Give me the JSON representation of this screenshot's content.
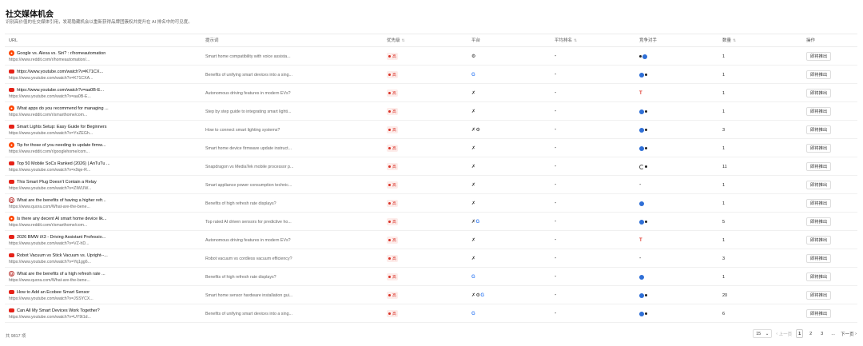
{
  "header": {
    "title": "社交媒体机会",
    "subtitle": "识别高价值的社交媒体引用，发现隐藏机会以重新获得品牌团簇权并提升在 AI 排名中的可见度。"
  },
  "columns": {
    "url": "URL",
    "prompt": "提示词",
    "priority": "优先级",
    "platform": "平台",
    "avg_rank": "平均排名",
    "competitors": "竞争对手",
    "count": "数量",
    "actions": "操作"
  },
  "rows": [
    {
      "source": "reddit",
      "title": "Google vs. Alexa vs. Siri? : r/homeautomation",
      "url": "https://www.reddit.com/r/homeautomation/...",
      "prompt": "Smart home compatibility with voice assista...",
      "priority": "高",
      "platforms": "⚙",
      "avg_rank": "-",
      "competitors": "dark-blue",
      "count": "1",
      "action": "即将推出"
    },
    {
      "source": "youtube",
      "title": "https://www.youtube.com/watch?v=K71CX...",
      "url": "https://www.youtube.com/watch?v=K71CXA...",
      "prompt": "Benefits of unifying smart devices into a sing...",
      "priority": "高",
      "platforms": "G",
      "avg_rank": "-",
      "competitors": "blue-dark",
      "count": "1",
      "action": "即将推出"
    },
    {
      "source": "youtube",
      "title": "https://www.youtube.com/watch?v=aa0B-E...",
      "url": "https://www.youtube.com/watch?v=aa0B-E...",
      "prompt": "Autonomous driving features in modern EVs?",
      "priority": "高",
      "platforms": "✗",
      "avg_rank": "-",
      "competitors": "red",
      "count": "1",
      "action": "即将推出"
    },
    {
      "source": "reddit",
      "title": "What apps do you recommend for managing ...",
      "url": "https://www.reddit.com/r/smarthome/com...",
      "prompt": "Step by step guide to integrating smart lighti...",
      "priority": "高",
      "platforms": "✗",
      "avg_rank": "-",
      "competitors": "blue-dark",
      "count": "1",
      "action": "即将推出"
    },
    {
      "source": "youtube",
      "title": "Smart Lights Setup: Easy Guide for Beginners",
      "url": "https://www.youtube.com/watch?v=YsZEGh...",
      "prompt": "How to connect smart lighting systems?",
      "priority": "高",
      "platforms": "✗⚙",
      "avg_rank": "-",
      "competitors": "blue-dark",
      "count": "3",
      "action": "即将推出"
    },
    {
      "source": "reddit",
      "title": "Tip for those of you needing to update firmw...",
      "url": "https://www.reddit.com/r/googlehome/com...",
      "prompt": "Smart home device firmware update instruct...",
      "priority": "高",
      "platforms": "✗",
      "avg_rank": "-",
      "competitors": "blue-dark",
      "count": "1",
      "action": "即将推出"
    },
    {
      "source": "youtube",
      "title": "Top 50 Mobile SoCs Ranked (2026) | AnTuTu ...",
      "url": "https://www.youtube.com/watch?v=x9qe-R...",
      "prompt": "Snapdragon vs MediaTek mobile processor p...",
      "priority": "高",
      "platforms": "✗",
      "avg_rank": "-",
      "competitors": "half-dark",
      "count": "11",
      "action": "即将推出"
    },
    {
      "source": "youtube",
      "title": "This Smart Plug Doesn't Contain a Relay",
      "url": "https://www.youtube.com/watch?v=ZIWUW...",
      "prompt": "Smart appliance power consumption technic...",
      "priority": "高",
      "platforms": "✗",
      "avg_rank": "-",
      "competitors": "none",
      "count": "1",
      "action": "即将推出"
    },
    {
      "source": "quora",
      "title": "What are the benefits of having a higher refr...",
      "url": "https://www.quora.com/What-are-the-bene...",
      "prompt": "Benefits of high refresh rate displays?",
      "priority": "高",
      "platforms": "✗",
      "avg_rank": "-",
      "competitors": "blue",
      "count": "1",
      "action": "即将推出"
    },
    {
      "source": "reddit",
      "title": "Is there any decent AI smart home device lik...",
      "url": "https://www.reddit.com/r/smarthome/com...",
      "prompt": "Top rated AI driven sensors for predictive ho...",
      "priority": "高",
      "platforms": "✗G",
      "avg_rank": "-",
      "competitors": "blue-dark",
      "count": "5",
      "action": "即将推出"
    },
    {
      "source": "youtube",
      "title": "2026 BMW iX3 - Driving Assistant Professio...",
      "url": "https://www.youtube.com/watch?v=VZ-hD...",
      "prompt": "Autonomous driving features in modern EVs?",
      "priority": "高",
      "platforms": "✗",
      "avg_rank": "-",
      "competitors": "red",
      "count": "1",
      "action": "即将推出"
    },
    {
      "source": "youtube",
      "title": "Robot Vacuum vs Stick Vacuum vs. Upright--...",
      "url": "https://www.youtube.com/watch?v=Yq1gg6...",
      "prompt": "Robot vacuum vs cordless vacuum efficiency?",
      "priority": "高",
      "platforms": "✗",
      "avg_rank": "-",
      "competitors": "none",
      "count": "3",
      "action": "即将推出"
    },
    {
      "source": "quora",
      "title": "What are the benefits of a high refresh rate ...",
      "url": "https://www.quora.com/What-are-the-bene...",
      "prompt": "Benefits of high refresh rate displays?",
      "priority": "高",
      "platforms": "G",
      "avg_rank": "-",
      "competitors": "blue",
      "count": "1",
      "action": "即将推出"
    },
    {
      "source": "youtube",
      "title": "How to Add an Ecobee Smart Sensor",
      "url": "https://www.youtube.com/watch?v=JSSYCX...",
      "prompt": "Smart home sensor hardware installation gui...",
      "priority": "高",
      "platforms": "✗⚙G",
      "avg_rank": "-",
      "competitors": "blue-dark",
      "count": "20",
      "action": "即将推出"
    },
    {
      "source": "youtube",
      "title": "Can All My Smart Devices Work Together?",
      "url": "https://www.youtube.com/watch?v=UY9t1d...",
      "prompt": "Benefits of unifying smart devices into a sing...",
      "priority": "高",
      "platforms": "G",
      "avg_rank": "-",
      "competitors": "blue-dark",
      "count": "6",
      "action": "即将推出"
    }
  ],
  "footer": {
    "total": "共 9817 项",
    "page_size": "15",
    "prev": "上一页",
    "pages": [
      "1",
      "2",
      "3"
    ],
    "ellipsis": "...",
    "next": "下一页"
  }
}
